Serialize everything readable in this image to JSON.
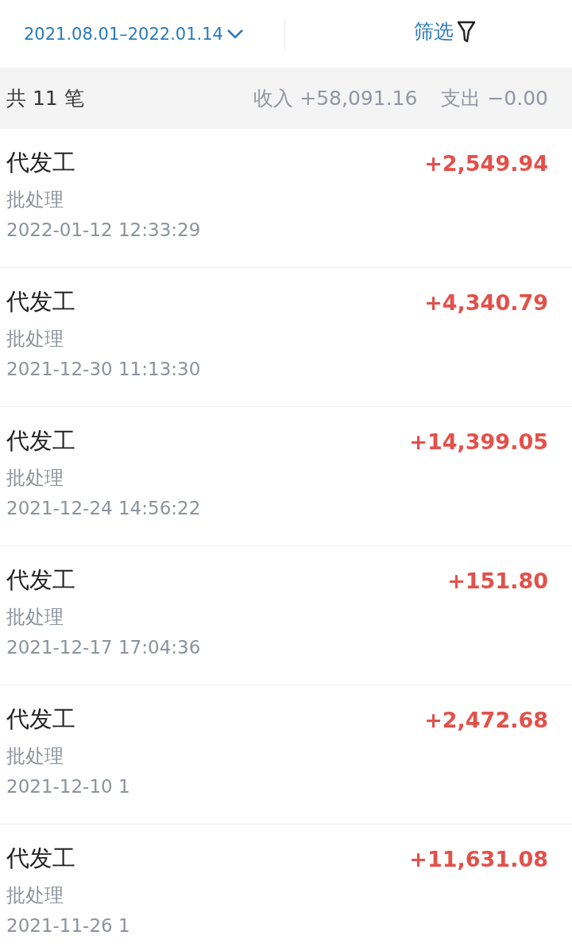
{
  "header": {
    "date_range": "2021.08.01–2022.01.14",
    "filter": "筛选"
  },
  "summary": {
    "count": "共 11 笔",
    "income": "收入 +58,091.16",
    "expense": "支出 −0.00"
  },
  "transactions": [
    {
      "title": "代发工",
      "type": "批处理",
      "time": "2022-01-12 12:33:29",
      "amount": "+2,549.94"
    },
    {
      "title": "代发工",
      "type": "批处理",
      "time": "2021-12-30 11:13:30",
      "amount": "+4,340.79"
    },
    {
      "title": "代发工",
      "type": "批处理",
      "time": "2021-12-24 14:56:22",
      "amount": "+14,399.05"
    },
    {
      "title": "代发工",
      "type": "批处理",
      "time": "2021-12-17 17:04:36",
      "amount": "+151.80"
    },
    {
      "title": "代发工",
      "type": "批处理",
      "time": "2021-12-10 1",
      "amount": "+2,472.68"
    },
    {
      "title": "代发工",
      "type": "批处理",
      "time": "2021-11-26 1",
      "amount": "+11,631.08"
    }
  ]
}
